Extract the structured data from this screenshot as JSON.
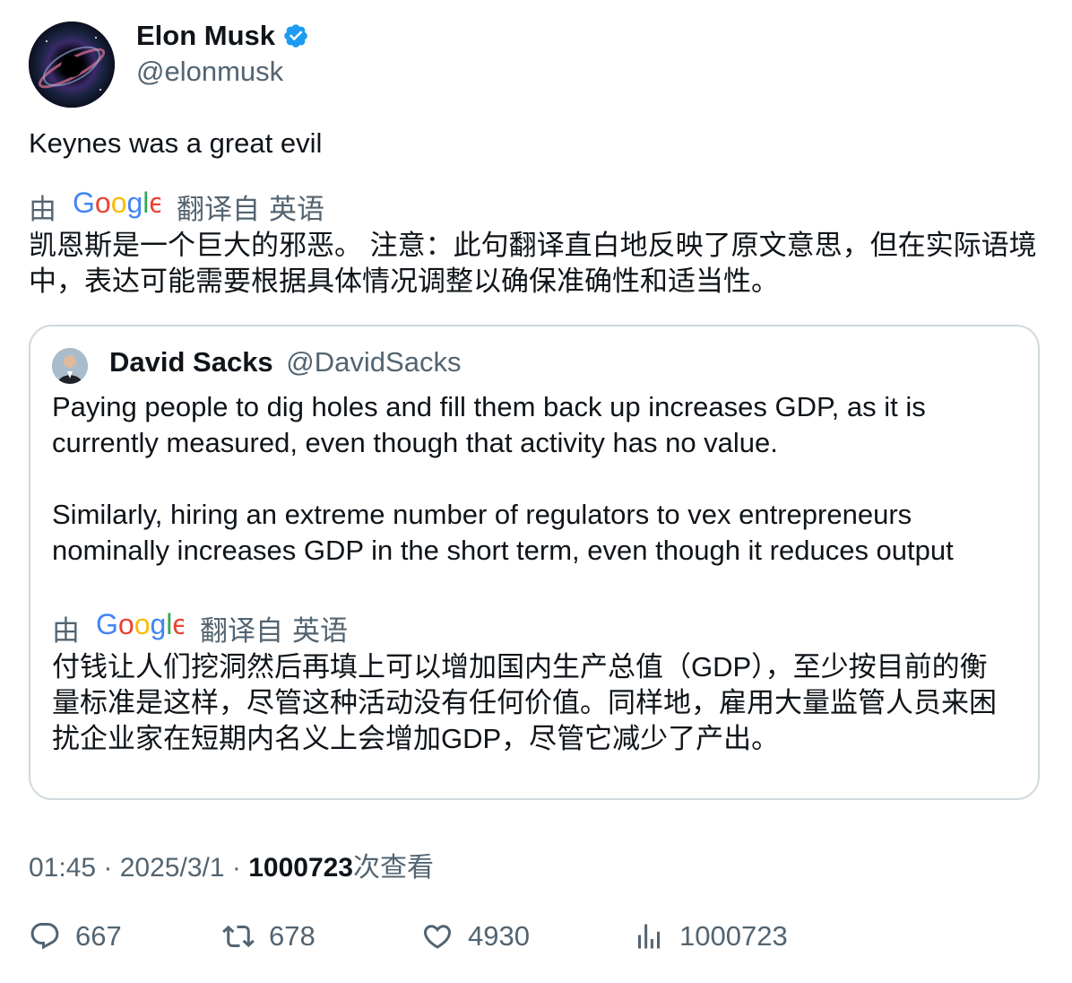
{
  "author": {
    "name": "Elon Musk",
    "handle": "@elonmusk",
    "verified_color": "#1d9bf0",
    "avatar_icon": "galaxy-avatar"
  },
  "tweet": {
    "text": "Keynes was a great evil",
    "translation_by": "由",
    "translation_suffix": "翻译自",
    "translation_lang": "英语",
    "translation": "凯恩斯是一个巨大的邪恶。 注意：此句翻译直白地反映了原文意思，但在实际语境中，表达可能需要根据具体情况调整以确保准确性和适当性。"
  },
  "quote": {
    "name": "David Sacks",
    "handle": "@DavidSacks",
    "paragraphs": [
      "Paying people to dig holes and fill them back up increases GDP, as it is currently measured, even though that activity has no value.",
      "Similarly, hiring an extreme number of regulators to vex entrepreneurs nominally increases GDP in the short term, even though it reduces output"
    ],
    "translation_by": "由",
    "translation_suffix": "翻译自",
    "translation_lang": "英语",
    "translation": "付钱让人们挖洞然后再填上可以增加国内生产总值（GDP），至少按目前的衡量标准是这样，尽管这种活动没有任何价值。同样地，雇用大量监管人员来困扰企业家在短期内名义上会增加GDP，尽管它减少了产出。"
  },
  "meta": {
    "time": "01:45",
    "date": "2025/3/1",
    "views": "1000723",
    "views_suffix": "次查看"
  },
  "actions": {
    "replies": "667",
    "retweets": "678",
    "likes": "4930",
    "views": "1000723"
  },
  "google_colors": {
    "blue": "#4285f4",
    "red": "#ea4335",
    "yellow": "#fbbc05",
    "green": "#34a853"
  }
}
